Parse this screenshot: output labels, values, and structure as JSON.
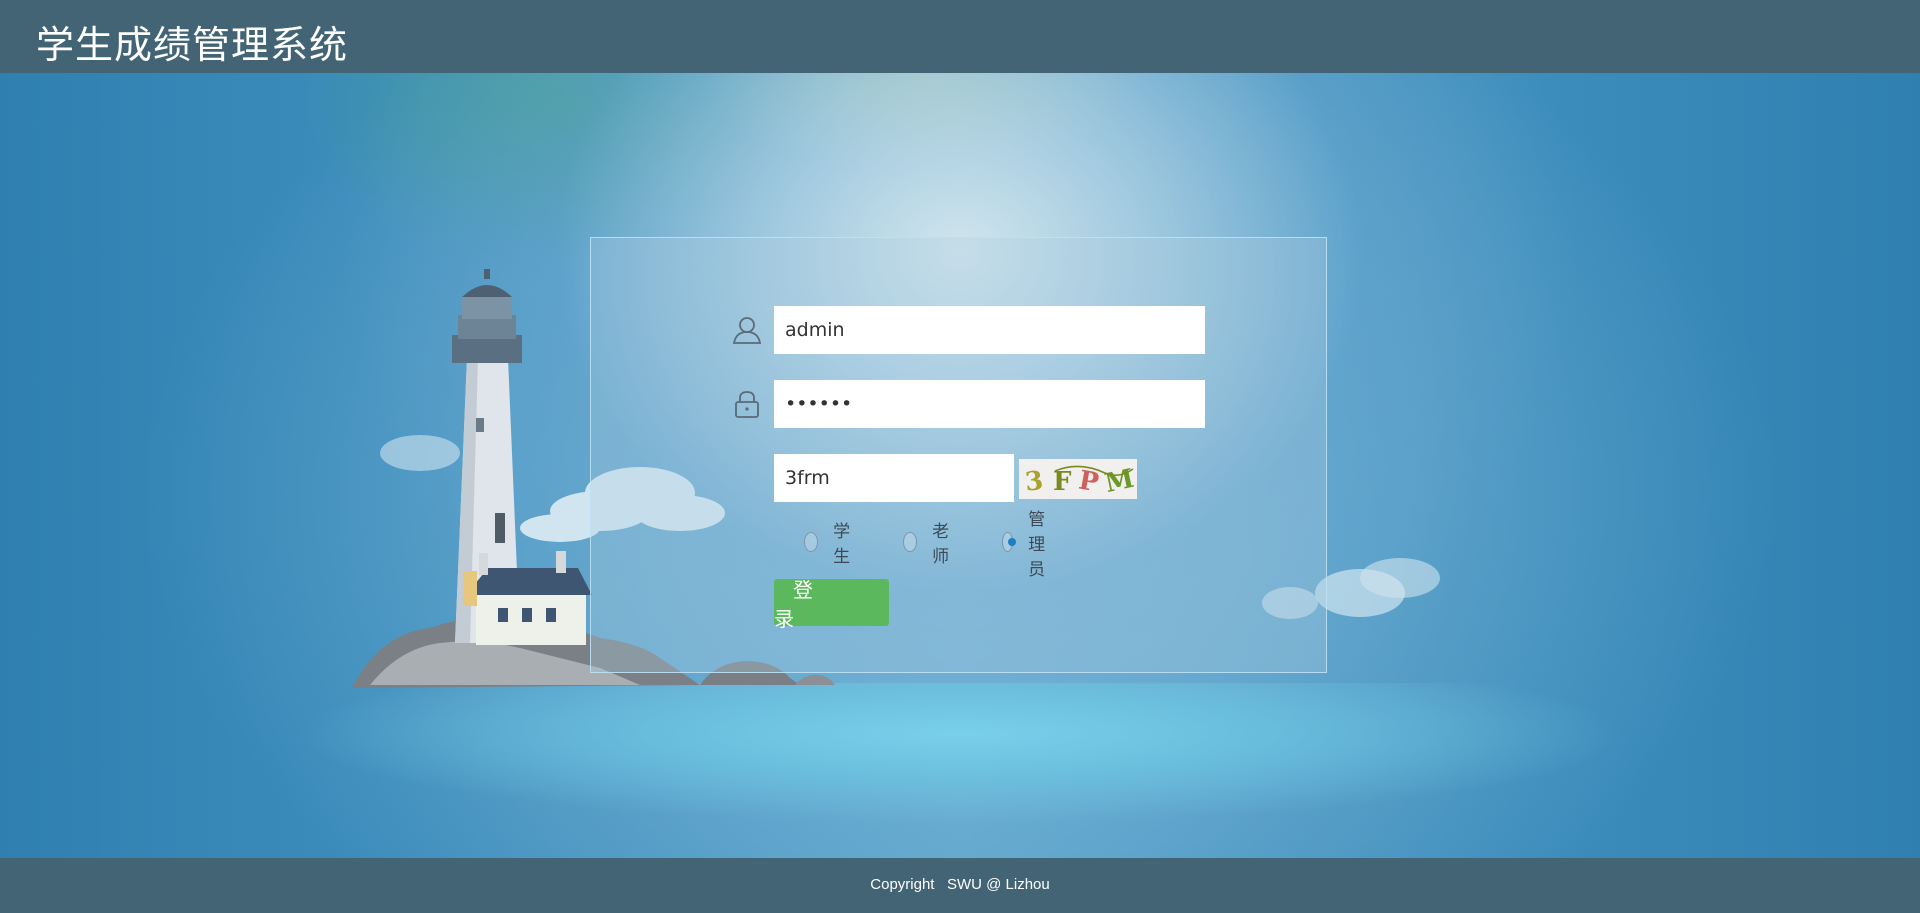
{
  "header": {
    "title": "学生成绩管理系统"
  },
  "login": {
    "username": {
      "value": "admin",
      "icon": "user-icon"
    },
    "password": {
      "value": "••••••",
      "icon": "lock-icon"
    },
    "captcha": {
      "value": "3frm",
      "image_text": "3FPM"
    },
    "roles": [
      {
        "label": "学生",
        "checked": false
      },
      {
        "label": "老师",
        "checked": false
      },
      {
        "label": "管理员",
        "checked": true
      }
    ],
    "submit_label": "登 录"
  },
  "footer": {
    "text": "Copyright   SWU @ Lizhou"
  },
  "colors": {
    "header_bg": "#426475",
    "footer_bg": "#426475",
    "button_bg": "#5cb85c",
    "radio_checked": "#1e7fc0"
  }
}
